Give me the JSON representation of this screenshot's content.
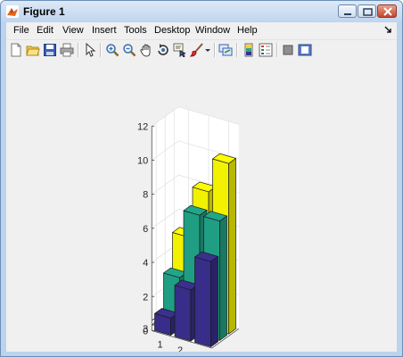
{
  "window": {
    "title": "Figure 1"
  },
  "menu": [
    "File",
    "Edit",
    "View",
    "Insert",
    "Tools",
    "Desktop",
    "Window",
    "Help"
  ],
  "toolbar_icons": [
    "new-figure-icon",
    "open-file-icon",
    "save-icon",
    "print-icon",
    "edit-plot-icon",
    "zoom-in-icon",
    "zoom-out-icon",
    "pan-icon",
    "rotate-3d-icon",
    "data-cursor-icon",
    "brush-icon",
    "brush-dropdown-icon",
    "link-plot-icon",
    "insert-colorbar-icon",
    "insert-legend-icon",
    "hide-plot-tools-icon",
    "show-plot-tools-icon"
  ],
  "colors": {
    "yellow": "#ffff00",
    "teal": "#21a68a",
    "purple": "#3b2f8f"
  },
  "chart_data": {
    "type": "bar3",
    "z_ticks": [
      "0",
      "2",
      "4",
      "6",
      "8",
      "10",
      "12"
    ],
    "zlim": [
      0,
      12
    ],
    "x_ticks": [
      "1",
      "2",
      "3"
    ],
    "y_ticks": [
      "1",
      "2",
      "3"
    ],
    "grid": true,
    "series": [
      {
        "color": "#ffff00",
        "values": [
          5,
          8,
          10
        ]
      },
      {
        "color": "#21a68a",
        "values": [
          3,
          7,
          7
        ]
      },
      {
        "color": "#3b2f8f",
        "values": [
          1,
          3,
          5
        ]
      }
    ]
  }
}
